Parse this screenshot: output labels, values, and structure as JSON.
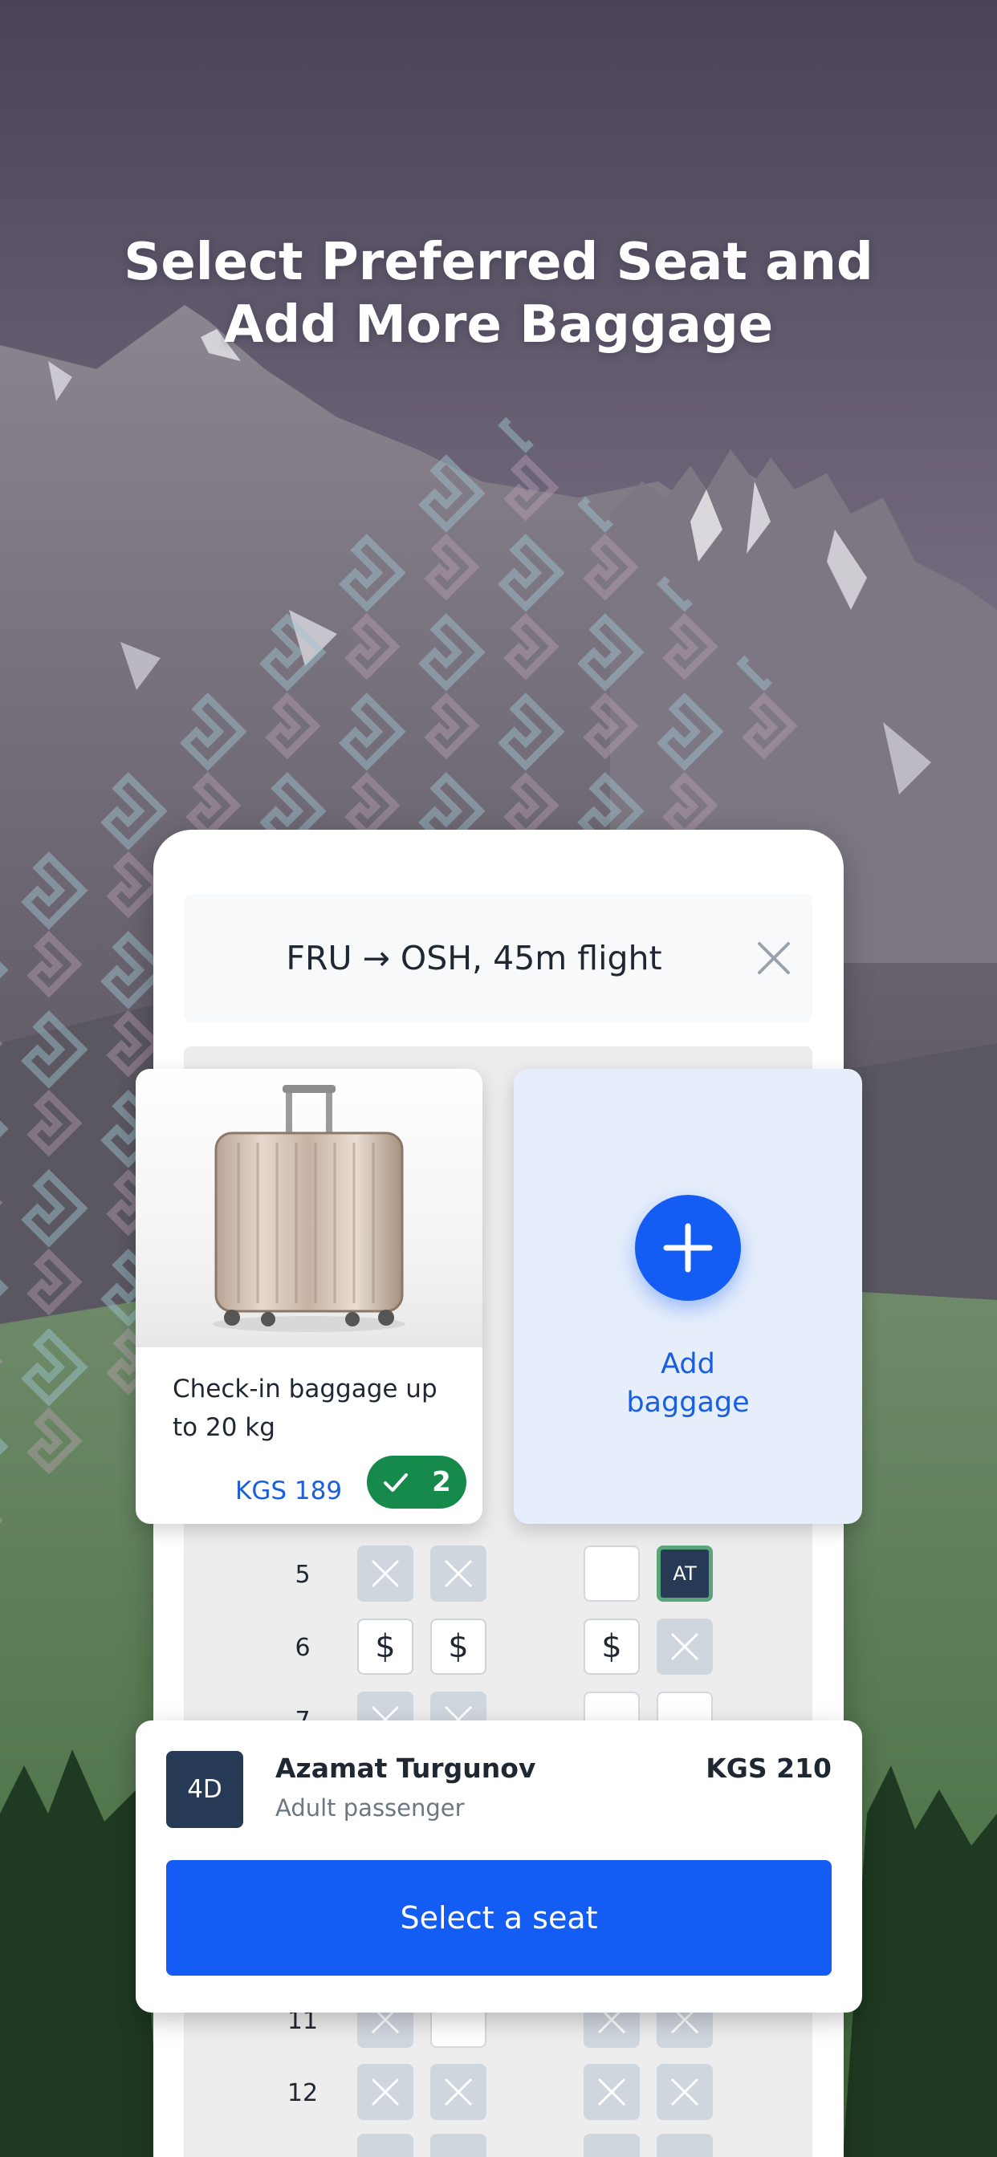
{
  "headline": {
    "line1": "Select Preferred Seat and",
    "line2": "Add More Baggage"
  },
  "route": {
    "text": "FRU → OSH, 45m flight",
    "close_icon": "close-icon"
  },
  "seatmap": {
    "rows": [
      {
        "number": "5",
        "seats": [
          "taken",
          "taken",
          "free",
          "mine"
        ],
        "mine_label": "AT"
      },
      {
        "number": "6",
        "seats": [
          "paid",
          "paid",
          "paid",
          "taken"
        ],
        "paid_symbol": "$"
      },
      {
        "number": "7",
        "seats": [
          "taken",
          "taken",
          "free",
          "free"
        ]
      },
      {
        "number": "11",
        "seats": [
          "taken",
          "free",
          "taken",
          "taken"
        ]
      },
      {
        "number": "12",
        "seats": [
          "taken",
          "taken",
          "taken",
          "taken"
        ]
      }
    ]
  },
  "baggage": {
    "title": "Check-in baggage up to 20 kg",
    "price": "KGS 189",
    "count": "2",
    "add_label_line1": "Add",
    "add_label_line2": "baggage"
  },
  "passenger": {
    "seat": "4D",
    "name": "Azamat Turgunov",
    "type": "Adult passenger",
    "price": "KGS 210",
    "button_label": "Select a seat"
  },
  "colors": {
    "accent": "#135df5",
    "dark_navy": "#263a55",
    "success": "#168a4a",
    "link_blue": "#1a5fe0"
  }
}
